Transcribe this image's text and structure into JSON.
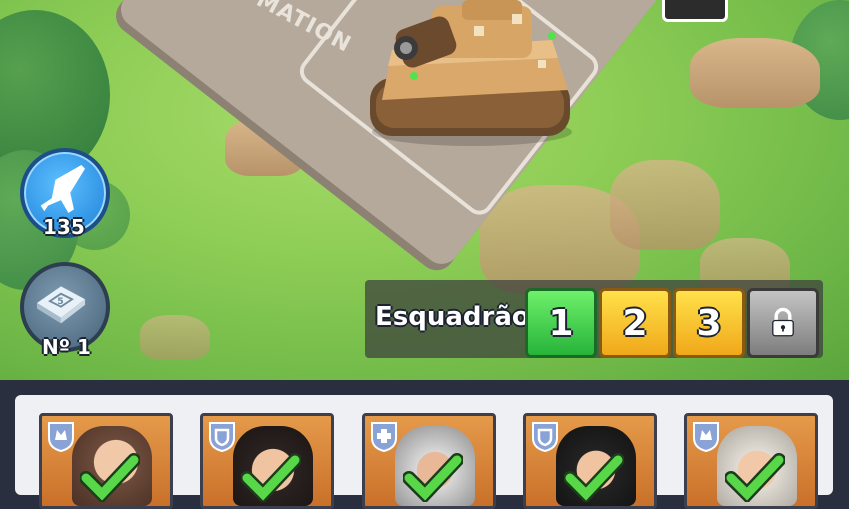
{
  "scene": {
    "pad_text": "MATION"
  },
  "left_buttons": {
    "airstrike": {
      "icon": "airplane-icon",
      "count": "135"
    },
    "map": {
      "icon": "map-icon",
      "label": "Nº 1"
    }
  },
  "squad": {
    "label": "Esquadrão",
    "buttons": [
      {
        "label": "1",
        "state": "selected",
        "color": "#3ccc4a"
      },
      {
        "label": "2",
        "state": "available",
        "color": "#f7c52a"
      },
      {
        "label": "3",
        "state": "available",
        "color": "#f7c52a"
      },
      {
        "icon": "lock-icon",
        "state": "locked",
        "color": "#9a9a9a"
      }
    ]
  },
  "heroes": [
    {
      "class_icon": "wolf-badge-icon",
      "selected": true
    },
    {
      "class_icon": "shield-badge-icon",
      "selected": true
    },
    {
      "class_icon": "medic-cross-badge-icon",
      "selected": true
    },
    {
      "class_icon": "shield-badge-icon",
      "selected": true
    },
    {
      "class_icon": "wolf-badge-icon",
      "selected": true
    }
  ]
}
